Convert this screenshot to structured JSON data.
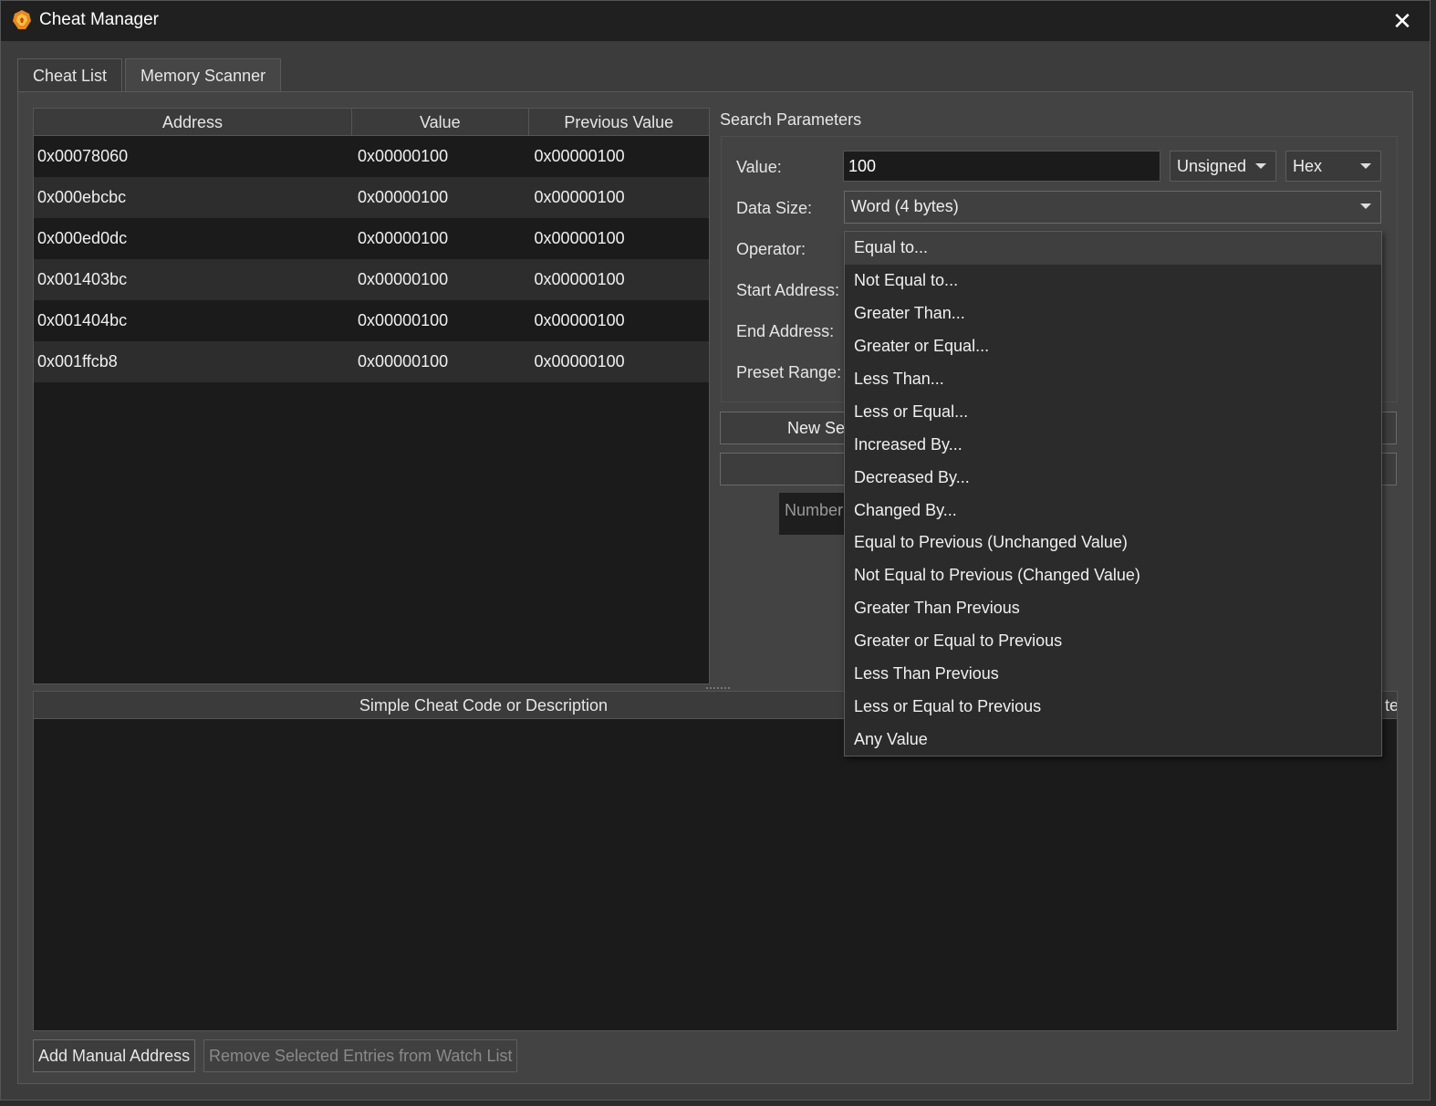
{
  "window": {
    "title": "Cheat Manager",
    "close_icon": "✕"
  },
  "tabs": [
    {
      "label": "Cheat List",
      "active": false
    },
    {
      "label": "Memory Scanner",
      "active": true
    }
  ],
  "results": {
    "headers": [
      "Address",
      "Value",
      "Previous Value"
    ],
    "rows": [
      [
        "0x00078060",
        "0x00000100",
        "0x00000100"
      ],
      [
        "0x000ebcbc",
        "0x00000100",
        "0x00000100"
      ],
      [
        "0x000ed0dc",
        "0x00000100",
        "0x00000100"
      ],
      [
        "0x001403bc",
        "0x00000100",
        "0x00000100"
      ],
      [
        "0x001404bc",
        "0x00000100",
        "0x00000100"
      ],
      [
        "0x001ffcb8",
        "0x00000100",
        "0x00000100"
      ]
    ]
  },
  "search": {
    "title": "Search Parameters",
    "value_label": "Value:",
    "value": "100",
    "signedness": "Unsigned",
    "base": "Hex",
    "data_size_label": "Data Size:",
    "data_size": "Word (4 bytes)",
    "operator_label": "Operator:",
    "start_label": "Start Address:",
    "end_label": "End Address:",
    "preset_label": "Preset Range:",
    "new_search_label": "New Sea",
    "count_text": "Number"
  },
  "operator_options": [
    "Equal to...",
    "Not Equal to...",
    "Greater Than...",
    "Greater or Equal...",
    "Less Than...",
    "Less or Equal...",
    "Increased By...",
    "Decreased By...",
    "Changed By...",
    "Equal to Previous (Unchanged Value)",
    "Not Equal to Previous (Changed Value)",
    "Greater Than Previous",
    "Greater or Equal to Previous",
    "Less Than Previous",
    "Less or Equal to Previous",
    "Any Value"
  ],
  "watch": {
    "header_description": "Simple Cheat Code or Description",
    "header_partial": "te"
  },
  "buttons": {
    "add_manual": "Add Manual Address",
    "remove_selected": "Remove Selected Entries from Watch List"
  },
  "colors": {
    "background": "#3c3c3c",
    "table_bg": "#1b1b1b",
    "titlebar": "#202020",
    "accent": "#f0a030"
  }
}
